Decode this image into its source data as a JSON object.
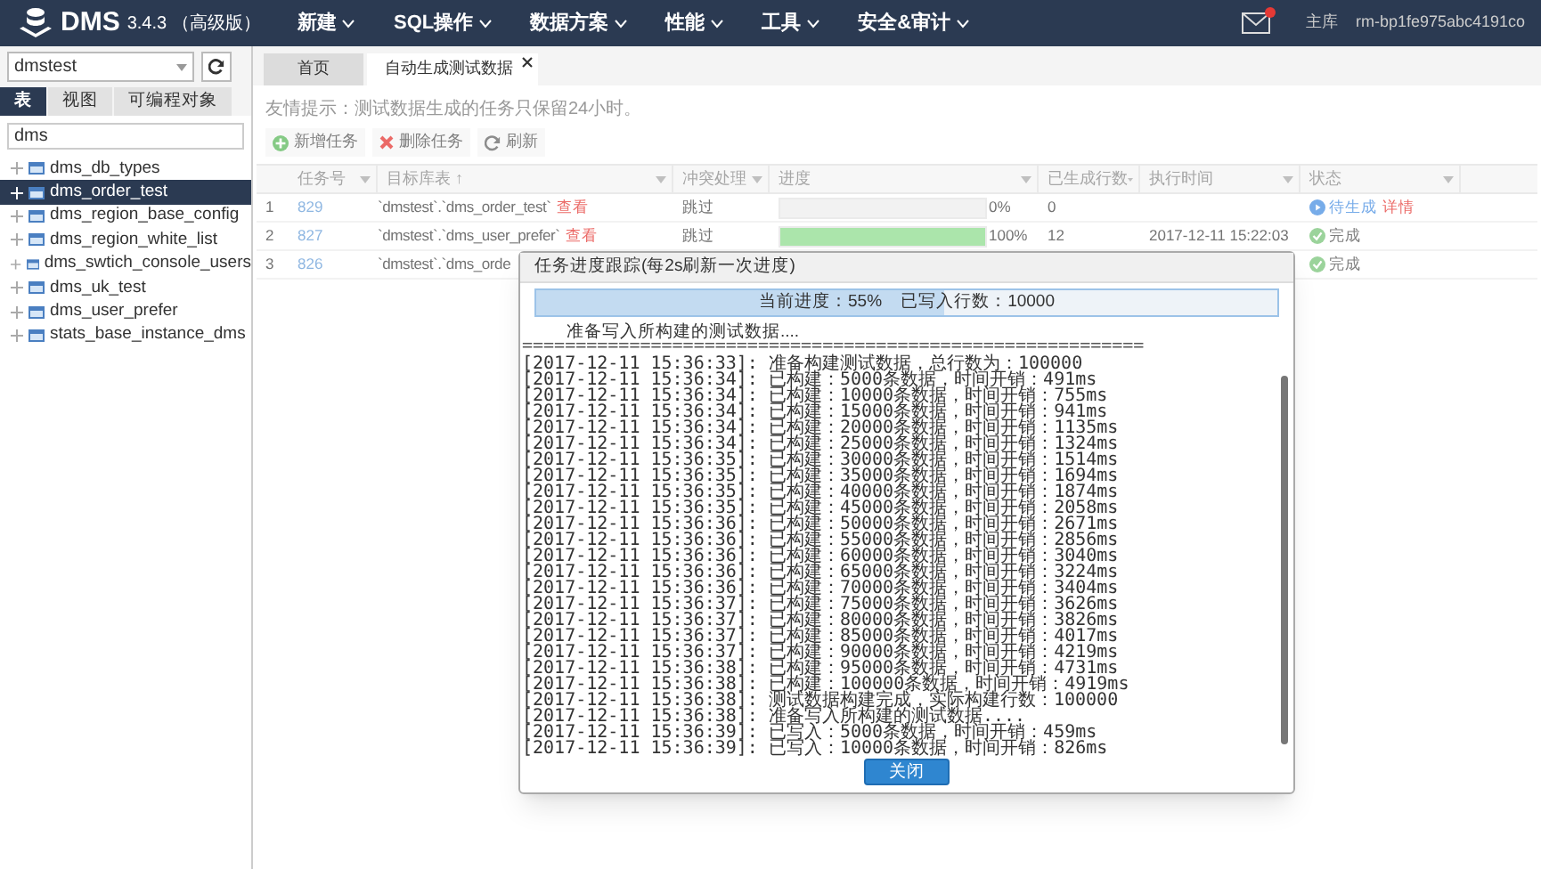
{
  "app": {
    "name": "DMS",
    "version": "3.4.3",
    "edition": "（高级版）"
  },
  "menu": [
    {
      "label": "新建"
    },
    {
      "label": "SQL操作"
    },
    {
      "label": "数据方案"
    },
    {
      "label": "性能"
    },
    {
      "label": "工具"
    },
    {
      "label": "安全&审计"
    }
  ],
  "header_right": {
    "has_notification": true,
    "role": "主库",
    "instance": "rm-bp1fe975abc4191co"
  },
  "sidebar": {
    "database": "dmstest",
    "tabs": [
      {
        "label": "表",
        "selected": true
      },
      {
        "label": "视图",
        "selected": false
      },
      {
        "label": "可编程对象",
        "selected": false
      }
    ],
    "filter": "dms",
    "tables": [
      {
        "name": "dms_db_types",
        "selected": false
      },
      {
        "name": "dms_order_test",
        "selected": true
      },
      {
        "name": "dms_region_base_config",
        "selected": false
      },
      {
        "name": "dms_region_white_list",
        "selected": false
      },
      {
        "name": "dms_swtich_console_users",
        "selected": false
      },
      {
        "name": "dms_uk_test",
        "selected": false
      },
      {
        "name": "dms_user_prefer",
        "selected": false
      },
      {
        "name": "stats_base_instance_dms",
        "selected": false
      }
    ]
  },
  "tabs": [
    {
      "label": "首页",
      "selected": false,
      "closable": false
    },
    {
      "label": "自动生成测试数据",
      "selected": true,
      "closable": true
    }
  ],
  "hint": "友情提示：测试数据生成的任务只保留24小时。",
  "toolbar": [
    {
      "label": "新增任务",
      "kind": "add"
    },
    {
      "label": "删除任务",
      "kind": "delete"
    },
    {
      "label": "刷新",
      "kind": "refresh"
    }
  ],
  "table": {
    "columns": [
      "任务号",
      "目标库表 ↑",
      "冲突处理",
      "进度",
      "已生成行数",
      "执行时间",
      "状态"
    ],
    "rows": [
      {
        "index": "1",
        "id": "829",
        "target": "`dmstest`.`dms_order_test`",
        "view_link": "查看",
        "conflict": "跳过",
        "level": 0,
        "percent": "0%",
        "rows": "0",
        "time": "",
        "status": "待生成",
        "kind": "pending",
        "detail_link": "详情"
      },
      {
        "index": "2",
        "id": "827",
        "target": "`dmstest`.`dms_user_prefer`",
        "view_link": "查看",
        "conflict": "跳过",
        "level": 1,
        "percent": "100%",
        "rows": "12",
        "time": "2017-12-11 15:22:03",
        "status": "完成",
        "kind": "done"
      },
      {
        "index": "3",
        "id": "826",
        "target": "`dmstest`.`dms_orde",
        "status": "完成",
        "kind": "done"
      }
    ]
  },
  "dialog": {
    "title": "任务进度跟踪(每2s刷新一次进度)",
    "progress_text": "当前进度：55%    已写入行数：10000",
    "level": 0.55,
    "message": "准备写入所构建的测试数据....",
    "separator": "==========================================================",
    "log": [
      "[2017-12-11 15:36:33]: 准备构建测试数据，总行数为：100000",
      "[2017-12-11 15:36:34]: 已构建：5000条数据，时间开销：491ms",
      "[2017-12-11 15:36:34]: 已构建：10000条数据，时间开销：755ms",
      "[2017-12-11 15:36:34]: 已构建：15000条数据，时间开销：941ms",
      "[2017-12-11 15:36:34]: 已构建：20000条数据，时间开销：1135ms",
      "[2017-12-11 15:36:34]: 已构建：25000条数据，时间开销：1324ms",
      "[2017-12-11 15:36:35]: 已构建：30000条数据，时间开销：1514ms",
      "[2017-12-11 15:36:35]: 已构建：35000条数据，时间开销：1694ms",
      "[2017-12-11 15:36:35]: 已构建：40000条数据，时间开销：1874ms",
      "[2017-12-11 15:36:35]: 已构建：45000条数据，时间开销：2058ms",
      "[2017-12-11 15:36:36]: 已构建：50000条数据，时间开销：2671ms",
      "[2017-12-11 15:36:36]: 已构建：55000条数据，时间开销：2856ms",
      "[2017-12-11 15:36:36]: 已构建：60000条数据，时间开销：3040ms",
      "[2017-12-11 15:36:36]: 已构建：65000条数据，时间开销：3224ms",
      "[2017-12-11 15:36:36]: 已构建：70000条数据，时间开销：3404ms",
      "[2017-12-11 15:36:37]: 已构建：75000条数据，时间开销：3626ms",
      "[2017-12-11 15:36:37]: 已构建：80000条数据，时间开销：3826ms",
      "[2017-12-11 15:36:37]: 已构建：85000条数据，时间开销：4017ms",
      "[2017-12-11 15:36:37]: 已构建：90000条数据，时间开销：4219ms",
      "[2017-12-11 15:36:38]: 已构建：95000条数据，时间开销：4731ms",
      "[2017-12-11 15:36:38]: 已构建：100000条数据，时间开销：4919ms",
      "[2017-12-11 15:36:38]: 测试数据构建完成，实际构建行数：100000",
      "[2017-12-11 15:36:38]: 准备写入所构建的测试数据....",
      "[2017-12-11 15:36:39]: 已写入：5000条数据，时间开销：459ms",
      "[2017-12-11 15:36:39]: 已写入：10000条数据，时间开销：826ms"
    ],
    "button": "关闭"
  }
}
